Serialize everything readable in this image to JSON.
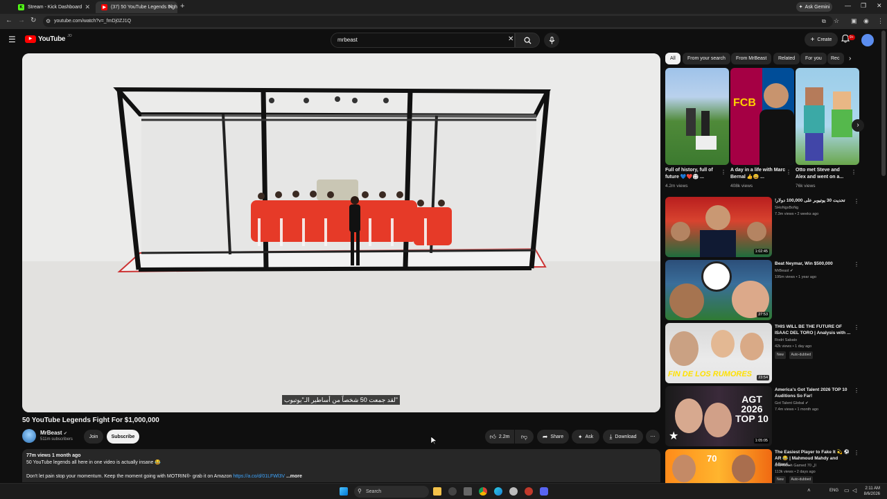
{
  "browser": {
    "tabs": [
      {
        "label": "Stream - Kick Dashboard",
        "icon": "kick-icon",
        "active": false
      },
      {
        "label": "(37) 50 YouTube Legends Figh",
        "icon": "youtube-icon",
        "active": true
      }
    ],
    "gemini_label": "Ask Gemini",
    "url": "youtube.com/watch?v=_fmDj0ZJ1Q"
  },
  "youtube": {
    "logo": "YouTube",
    "logo_sup": "JO",
    "search_value": "mrbeast",
    "create_label": "Create",
    "notif_count": "9+"
  },
  "video": {
    "subtitle": "\"لقد جمعت 50 شخصاً من أساطير الـ\"يوتيوب",
    "title": "50 YouTube Legends Fight For $1,000,000",
    "channel": "MrBeast",
    "subscribers": "511m subscribers",
    "join_label": "Join",
    "subscribe_label": "Subscribe",
    "likes": "2.2m",
    "share_label": "Share",
    "ask_label": "Ask",
    "download_label": "Download",
    "description": {
      "stats": "77m views  1 month ago",
      "line1": "50 YouTube legends all here in one video is actually insane 😂",
      "line2": "Don't let pain stop your momentum. Keep the moment going with MOTRIN®- grab it on Amazon",
      "link": "https://a.co/d/01LFWl3V",
      "more": "...more"
    }
  },
  "sidebar": {
    "chips": [
      "All",
      "From your search",
      "From MrBeast",
      "Related",
      "For you",
      "Rec"
    ],
    "shorts": [
      {
        "title": "Full of history, full of future 💙❤️🏟 ...",
        "views": "4.2m views"
      },
      {
        "title": "A day in a life with Marc Bernal 👍😄 ...",
        "views": "408k views"
      },
      {
        "title": "Otto met Steve and Alex and went on a...",
        "views": "76k views"
      }
    ],
    "videos": [
      {
        "title": "تحديت 30 يوتيوبر على 100,000 دولار!",
        "channel": "SHoNgxBoNg",
        "meta": "7.3m views • 2 weeks ago",
        "duration": "1:02:45",
        "tags": []
      },
      {
        "title": "Beat Neymar, Win $500,000",
        "channel": "MrBeast",
        "meta": "195m views • 1 year ago",
        "duration": "27:53",
        "tags": []
      },
      {
        "title": "THIS WILL BE THE FUTURE OF ISAAC DEL TORO | Analysis with ...",
        "channel": "Rodri Sabato",
        "meta": "42k views • 1 day ago",
        "duration": "23:54",
        "tags": [
          "New",
          "Auto-dubbed"
        ]
      },
      {
        "title": "America's Got Talent 2026 TOP 10 Auditions So Far!",
        "channel": "Got Talent Global",
        "meta": "7.4m views • 1 month ago",
        "duration": "1:05:05",
        "tags": []
      },
      {
        "title": "The Easiest Player to Fake It 💫 ⚽ AR 😂 | Mahmoud Mahdy and Allawi...",
        "channel": "and Match Gamed 70 ال",
        "meta": "113k views • 2 days ago",
        "duration": "",
        "tags": [
          "New",
          "Auto-dubbed"
        ]
      }
    ],
    "thumb_texts": {
      "fcb": "FCB",
      "fin": "FIN DE LOS RUMORES",
      "agt": "AGT 2026 TOP 10",
      "badge70": "70"
    }
  },
  "taskbar": {
    "search_label": "Search",
    "lang": "ENG",
    "time": "2:11 AM",
    "date": "8/6/2026"
  }
}
